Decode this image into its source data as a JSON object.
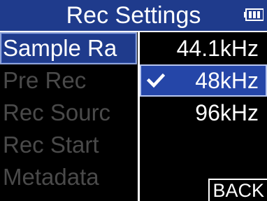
{
  "title": "Rec Settings",
  "battery_icon": "battery-full-icon",
  "menu": {
    "items": [
      {
        "label": "Sample Ra",
        "selected": true
      },
      {
        "label": "Pre Rec",
        "selected": false
      },
      {
        "label": "Rec Sourc",
        "selected": false
      },
      {
        "label": "Rec Start",
        "selected": false
      },
      {
        "label": "Metadata",
        "selected": false
      }
    ]
  },
  "options": {
    "items": [
      {
        "label": "44.1kHz",
        "selected": false
      },
      {
        "label": "48kHz",
        "selected": true
      },
      {
        "label": "96kHz",
        "selected": false
      }
    ],
    "check_icon": "checkmark-icon"
  },
  "back_label": "BACK",
  "colors": {
    "title_bg": "#1f3b8c",
    "selected_bg": "#2546a8",
    "dim_text": "#4a4a4a",
    "text": "#ffffff",
    "background": "#000000"
  }
}
